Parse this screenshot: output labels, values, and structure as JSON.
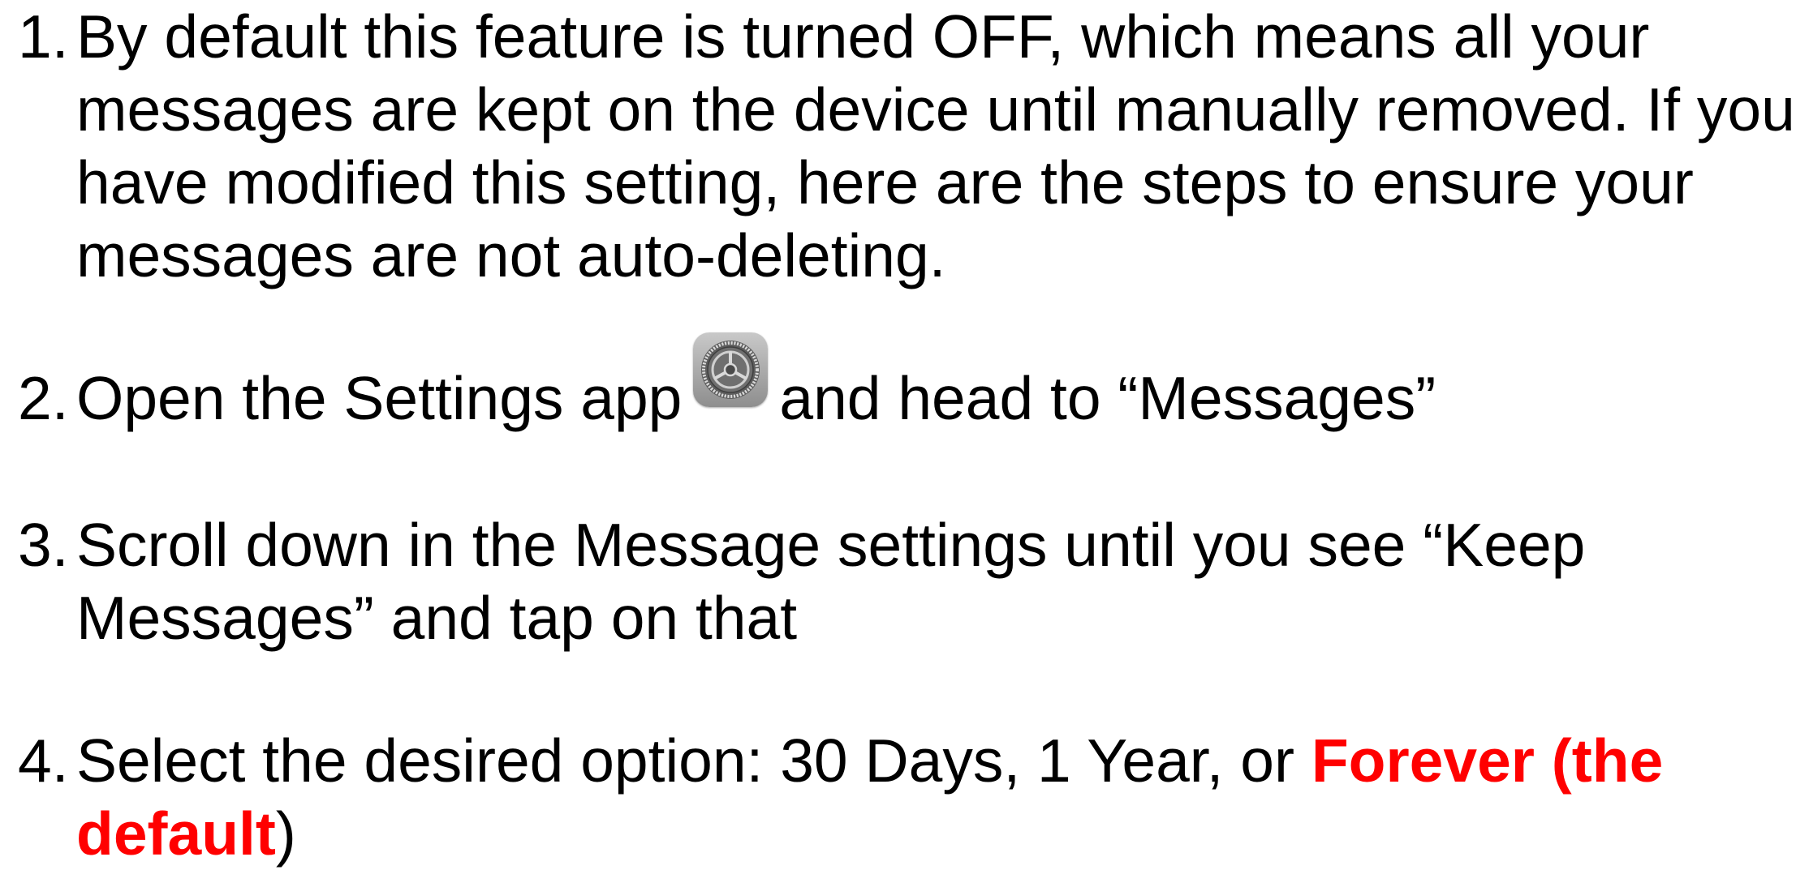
{
  "steps": [
    {
      "number": "1.",
      "lines": [
        "By default this feature is turned OFF, which means all your",
        "messages are kept on the device until manually removed. If you",
        "have modified this setting, here are the steps to ensure your",
        "messages are not auto-deleting."
      ]
    },
    {
      "number": "2.",
      "text_before_icon": "Open the Settings app",
      "icon": "settings-gear-icon",
      "text_after_icon": "and head to “Messages”"
    },
    {
      "number": "3.",
      "lines": [
        "Scroll down in the Message settings until you see “Keep",
        "Messages” and tap on that"
      ]
    },
    {
      "number": "4.",
      "line1_plain": "Select the desired option: 30 Days, 1 Year, or ",
      "line1_accent": "Forever (the",
      "line2_accent": "default",
      "line2_plain": ")"
    }
  ],
  "colors": {
    "text": "#000000",
    "accent": "#ff0000",
    "background": "#ffffff"
  }
}
